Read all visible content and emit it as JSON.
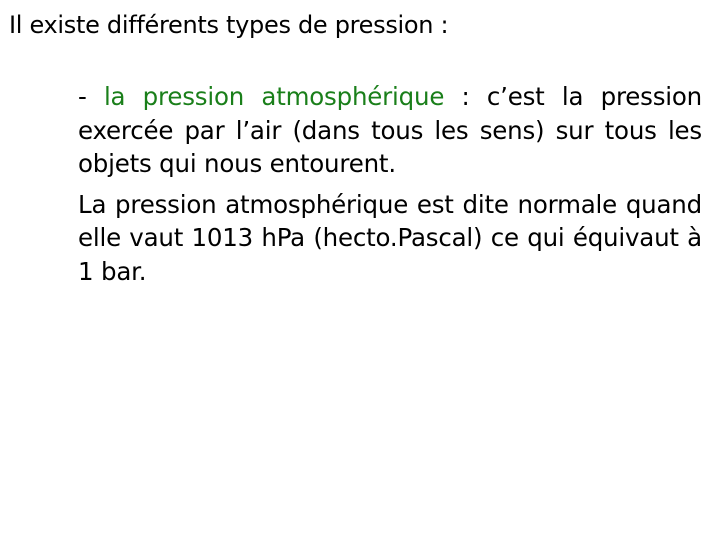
{
  "slide": {
    "title": "Il existe différents types de pression :",
    "accent_color": "#1a7f1a",
    "paragraphs": [
      {
        "bullet": "- ",
        "term": "la pression atmosphérique",
        "rest": " : c’est la pression exercée par l’air (dans tous les sens) sur tous les objets qui nous entourent."
      },
      {
        "text": "La pression atmosphérique est dite normale quand elle vaut 1013 hPa (hecto.Pascal) ce qui équivaut à 1 bar."
      }
    ]
  }
}
